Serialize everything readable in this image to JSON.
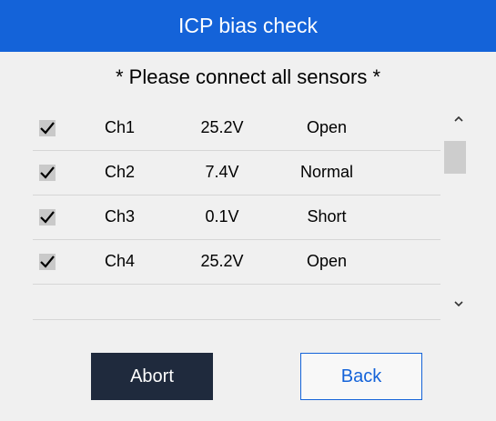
{
  "dialog": {
    "title": "ICP bias check",
    "notice": "* Please connect all sensors *"
  },
  "channels": [
    {
      "checked": true,
      "channel": "Ch1",
      "voltage": "25.2V",
      "status": "Open"
    },
    {
      "checked": true,
      "channel": "Ch2",
      "voltage": "7.4V",
      "status": "Normal"
    },
    {
      "checked": true,
      "channel": "Ch3",
      "voltage": "0.1V",
      "status": "Short"
    },
    {
      "checked": true,
      "channel": "Ch4",
      "voltage": "25.2V",
      "status": "Open"
    }
  ],
  "buttons": {
    "abort_label": "Abort",
    "back_label": "Back"
  },
  "icons": {
    "check": "checkmark-icon",
    "scroll_up": "chevron-up-icon",
    "scroll_down": "chevron-down-icon"
  },
  "colors": {
    "title_bar": "#1463d9",
    "abort_button": "#1f2a3d",
    "back_border": "#1463d9"
  }
}
